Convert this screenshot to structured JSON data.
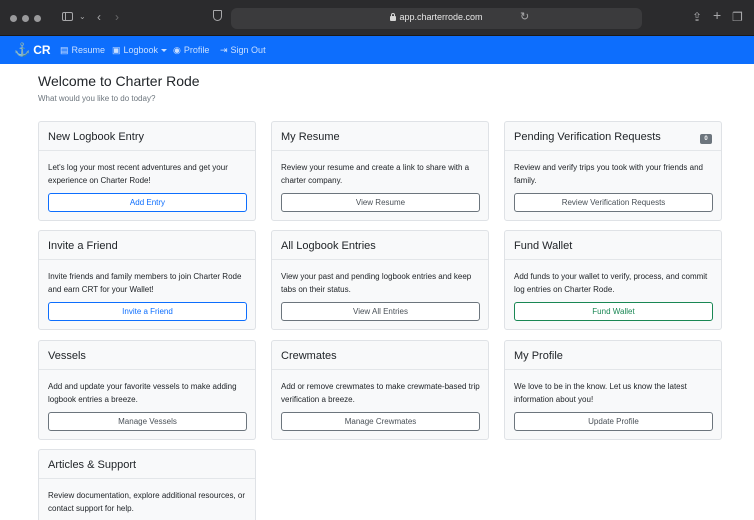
{
  "browser": {
    "url": "app.charterrode.com"
  },
  "navbar": {
    "brand": "CR",
    "items": [
      {
        "label": "Resume",
        "icon": "document-icon"
      },
      {
        "label": "Logbook",
        "icon": "book-icon",
        "dropdown": true
      },
      {
        "label": "Profile",
        "icon": "user-circle-icon"
      },
      {
        "label": "Sign Out",
        "icon": "sign-out-icon"
      }
    ]
  },
  "header": {
    "title": "Welcome to Charter Rode",
    "subtitle": "What would you like to do today?"
  },
  "cards": [
    {
      "title": "New Logbook Entry",
      "text": "Let's log your most recent adventures and get your experience on Charter Rode!",
      "button": "Add Entry",
      "style": "primary"
    },
    {
      "title": "My Resume",
      "text": "Review your resume and create a link to share with a charter company.",
      "button": "View Resume",
      "style": "secondary"
    },
    {
      "title": "Pending Verification Requests",
      "text": "Review and verify trips you took with your friends and family.",
      "button": "Review Verification Requests",
      "style": "secondary",
      "badge": "0"
    },
    {
      "title": "Invite a Friend",
      "text": "Invite friends and family members to join Charter Rode and earn CRT for your Wallet!",
      "button": "Invite a Friend",
      "style": "primary"
    },
    {
      "title": "All Logbook Entries",
      "text": "View your past and pending logbook entries and keep tabs on their status.",
      "button": "View All Entries",
      "style": "secondary"
    },
    {
      "title": "Fund Wallet",
      "text": "Add funds to your wallet to verify, process, and commit log entries on Charter Rode.",
      "button": "Fund Wallet",
      "style": "success"
    },
    {
      "title": "Vessels",
      "text": "Add and update your favorite vessels to make adding logbook entries a breeze.",
      "button": "Manage Vessels",
      "style": "secondary"
    },
    {
      "title": "Crewmates",
      "text": "Add or remove crewmates to make crewmate-based trip verification a breeze.",
      "button": "Manage Crewmates",
      "style": "secondary"
    },
    {
      "title": "My Profile",
      "text": "We love to be in the know. Let us know the latest information about you!",
      "button": "Update Profile",
      "style": "secondary"
    },
    {
      "title": "Articles & Support",
      "text": "Review documentation, explore additional resources, or contact support for help.",
      "button": "",
      "style": "secondary"
    }
  ],
  "colors": {
    "navbar": "#0d6efd",
    "primary": "#0d6efd",
    "success": "#198754",
    "secondary": "#6c757d"
  }
}
